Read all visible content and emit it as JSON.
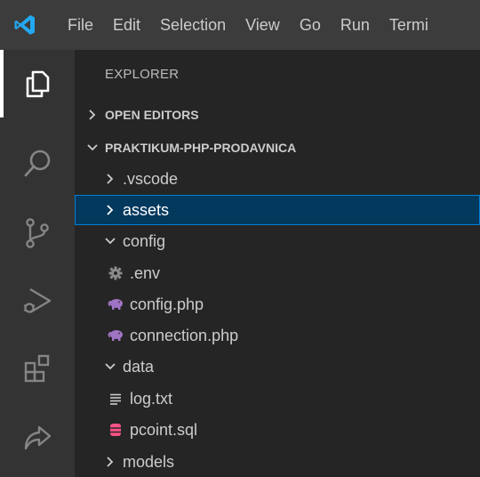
{
  "menubar": {
    "items": [
      "File",
      "Edit",
      "Selection",
      "View",
      "Go",
      "Run",
      "Termi"
    ]
  },
  "sidebar": {
    "title": "EXPLORER",
    "open_editors_label": "OPEN EDITORS",
    "project_label": "PRAKTIKUM-PHP-PRODAVNICA",
    "tree": [
      {
        "label": ".vscode",
        "type": "folder",
        "expanded": false
      },
      {
        "label": "assets",
        "type": "folder",
        "expanded": false,
        "selected": true
      },
      {
        "label": "config",
        "type": "folder",
        "expanded": true
      },
      {
        "label": ".env",
        "type": "file",
        "icon": "gear-icon"
      },
      {
        "label": "config.php",
        "type": "file",
        "icon": "php-icon"
      },
      {
        "label": "connection.php",
        "type": "file",
        "icon": "php-icon"
      },
      {
        "label": "data",
        "type": "folder",
        "expanded": true
      },
      {
        "label": "log.txt",
        "type": "file",
        "icon": "text-lines-icon"
      },
      {
        "label": "pcoint.sql",
        "type": "file",
        "icon": "database-icon"
      },
      {
        "label": "models",
        "type": "folder",
        "expanded": false
      }
    ]
  },
  "colors": {
    "accent": "#007acc",
    "selection_bg": "#04395e",
    "selection_border": "#007fd4",
    "php_icon": "#a074c4",
    "sql_icon": "#f55385"
  }
}
